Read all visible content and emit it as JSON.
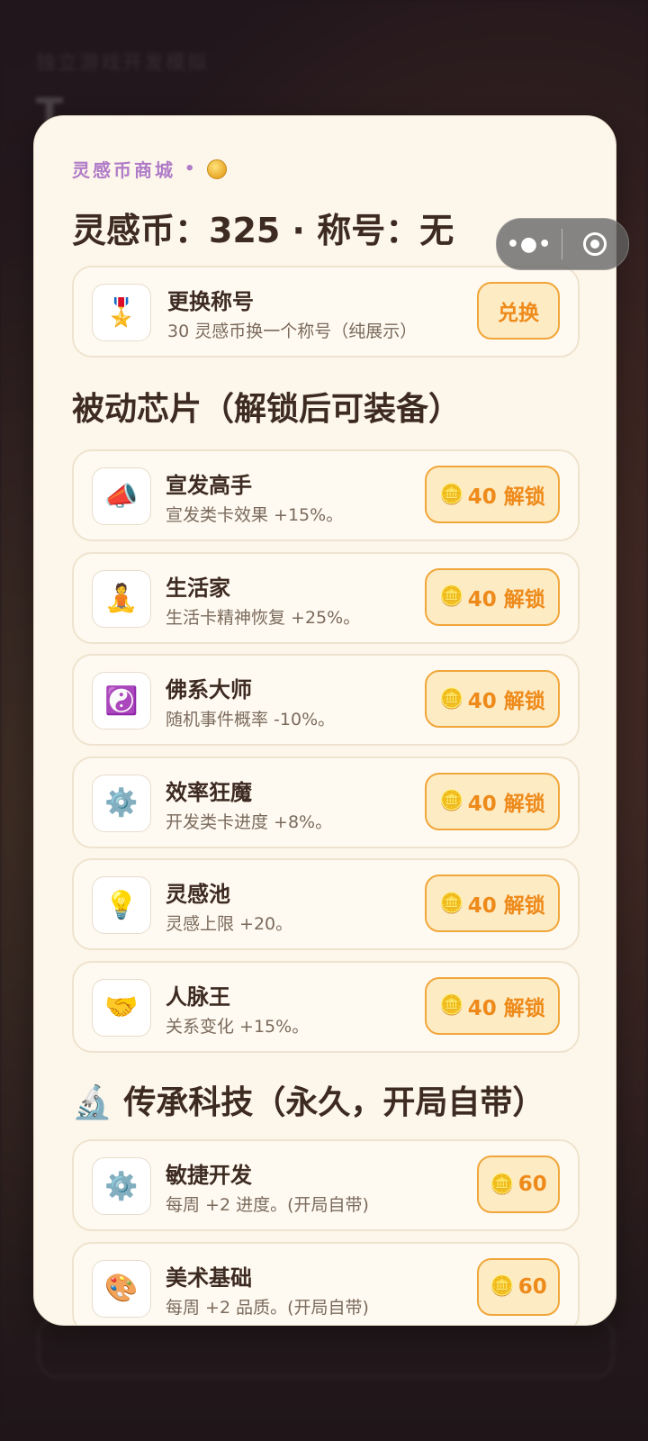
{
  "background": {
    "title": "独立游戏开发模拟",
    "big_text": "T    … ."
  },
  "capsule": {
    "more_label": "•●•"
  },
  "shop": {
    "kicker": "灵感币商城",
    "kicker_dot": "•",
    "header": "灵感币：325 · 称号：无",
    "title_row": {
      "icon": "🎖️",
      "title": "更换称号",
      "desc": "30 灵感币换一个称号（纯展示）",
      "button": "兑换"
    }
  },
  "chips_section": {
    "title": "被动芯片（解锁后可装备）",
    "items": [
      {
        "icon": "📣",
        "title": "宣发高手",
        "desc": "宣发类卡效果 +15%。",
        "coin": "🪙",
        "button": "40 解锁"
      },
      {
        "icon": "🧘",
        "title": "生活家",
        "desc": "生活卡精神恢复 +25%。",
        "coin": "🪙",
        "button": "40 解锁"
      },
      {
        "icon": "☯️",
        "title": "佛系大师",
        "desc": "随机事件概率 -10%。",
        "coin": "🪙",
        "button": "40 解锁"
      },
      {
        "icon": "⚙️",
        "title": "效率狂魔",
        "desc": "开发类卡进度 +8%。",
        "coin": "🪙",
        "button": "40 解锁"
      },
      {
        "icon": "💡",
        "title": "灵感池",
        "desc": "灵感上限 +20。",
        "coin": "🪙",
        "button": "40 解锁"
      },
      {
        "icon": "🤝",
        "title": "人脉王",
        "desc": "关系变化 +15%。",
        "coin": "🪙",
        "button": "40 解锁"
      }
    ]
  },
  "tech_section": {
    "icon": "🔬",
    "title": "传承科技（永久，开局自带）",
    "items": [
      {
        "icon": "⚙️",
        "title": "敏捷开发",
        "desc": "每周 +2 进度。(开局自带)",
        "coin": "🪙",
        "button": "60"
      },
      {
        "icon": "🎨",
        "title": "美术基础",
        "desc": "每周 +2 品质。(开局自带)",
        "coin": "🪙",
        "button": "60"
      }
    ]
  },
  "colors": {
    "card_bg": "#fdf6ea",
    "accent_orange": "#ee8a1a",
    "kicker_purple": "#b07cc8",
    "title_brown": "#3d2b22"
  }
}
